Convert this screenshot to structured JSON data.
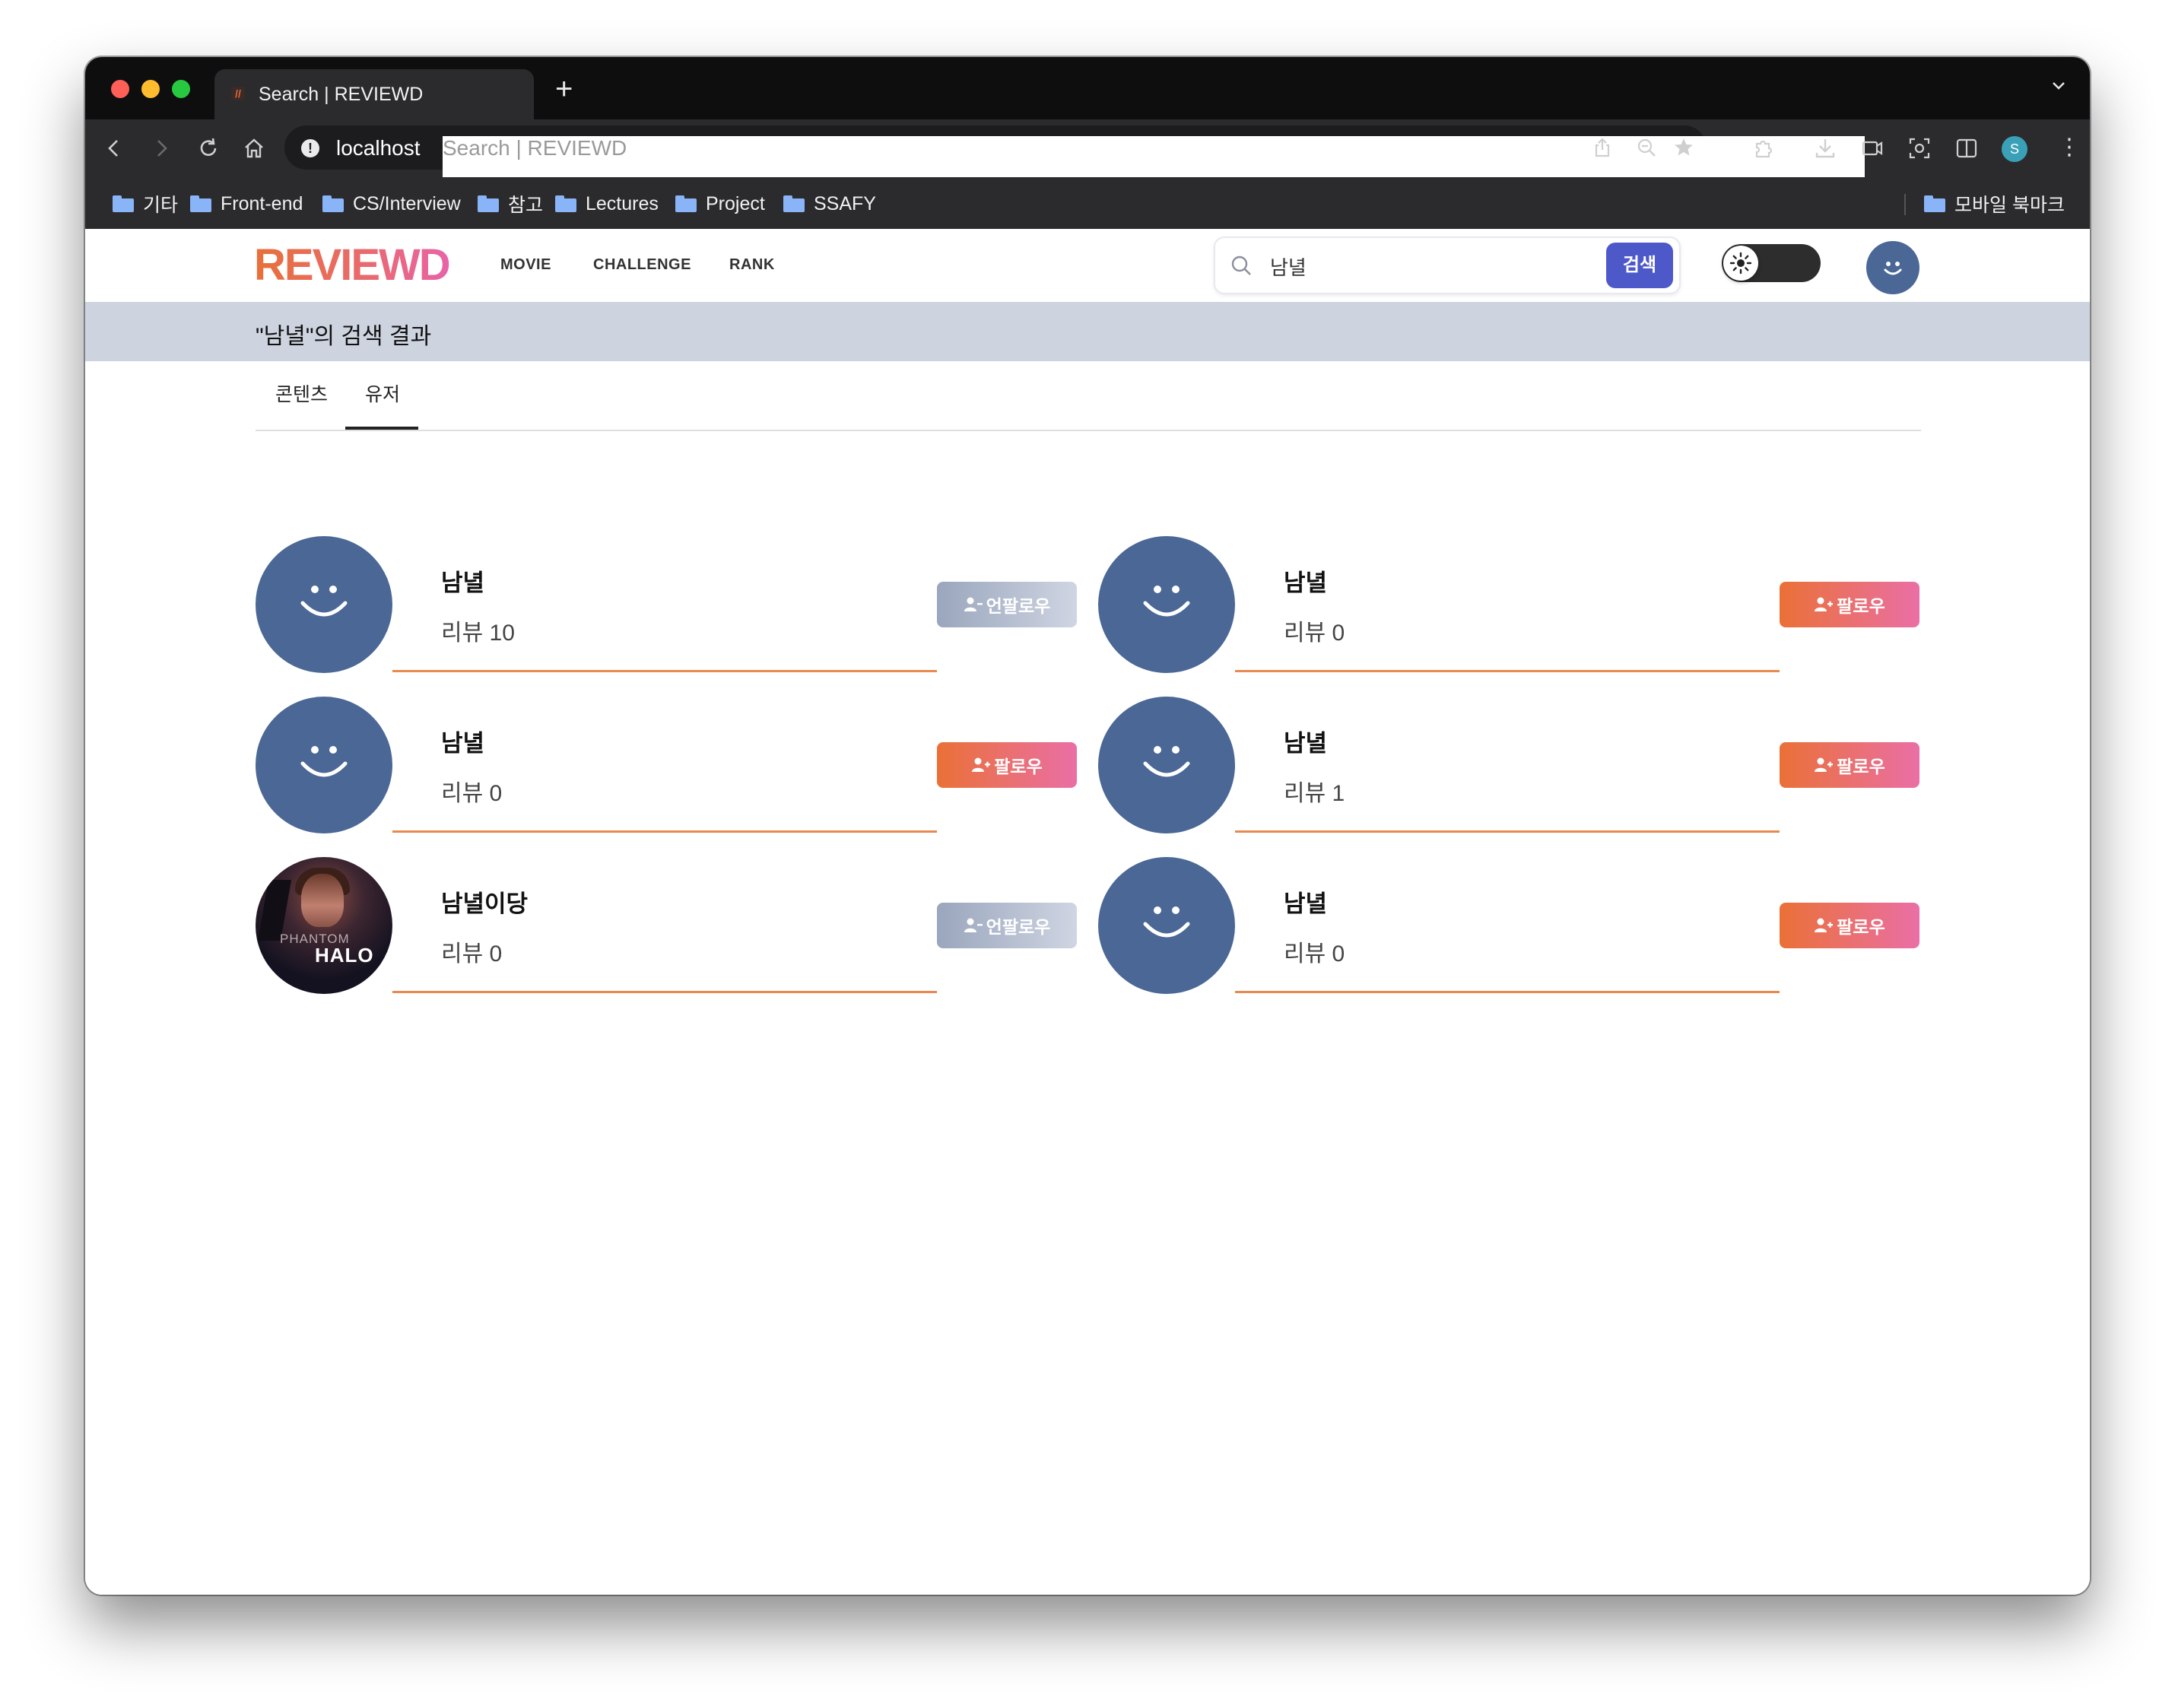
{
  "browser": {
    "tab_title": "Search | REVIEWD",
    "new_tab": "+",
    "url_host": "localhost",
    "url_page_title": "Search | REVIEWD",
    "profile_initial": "S",
    "bookmarks": [
      "기타",
      "Front-end",
      "CS/Interview",
      "참고",
      "Lectures",
      "Project",
      "SSAFY"
    ],
    "mobile_bookmarks": "모바일 북마크"
  },
  "site": {
    "logo": "REVIEWD",
    "nav": [
      "MOVIE",
      "CHALLENGE",
      "RANK"
    ],
    "search": {
      "value": "남녈",
      "button_label": "검색"
    },
    "theme": "light",
    "accent_color": "#4d59c9",
    "follow_color": "#ea7037",
    "avatar_color": "#4a6796"
  },
  "results": {
    "heading": "\"남녈\"의 검색 결과",
    "tabs": [
      {
        "label": "콘텐츠",
        "active": false
      },
      {
        "label": "유저",
        "active": true
      }
    ],
    "users": [
      {
        "name": "남녈",
        "reviews": "리뷰 10",
        "button": "언팔로우",
        "following": true,
        "avatar": "smiley"
      },
      {
        "name": "남녈",
        "reviews": "리뷰 0",
        "button": "팔로우",
        "following": false,
        "avatar": "smiley"
      },
      {
        "name": "남녈",
        "reviews": "리뷰 0",
        "button": "팔로우",
        "following": false,
        "avatar": "smiley"
      },
      {
        "name": "남녈",
        "reviews": "리뷰 1",
        "button": "팔로우",
        "following": false,
        "avatar": "smiley"
      },
      {
        "name": "남녈이당",
        "reviews": "리뷰 0",
        "button": "언팔로우",
        "following": true,
        "avatar": "poster",
        "avatar_text": [
          "PHANTOM",
          "HALO"
        ]
      },
      {
        "name": "남녈",
        "reviews": "리뷰 0",
        "button": "팔로우",
        "following": false,
        "avatar": "smiley"
      }
    ]
  }
}
